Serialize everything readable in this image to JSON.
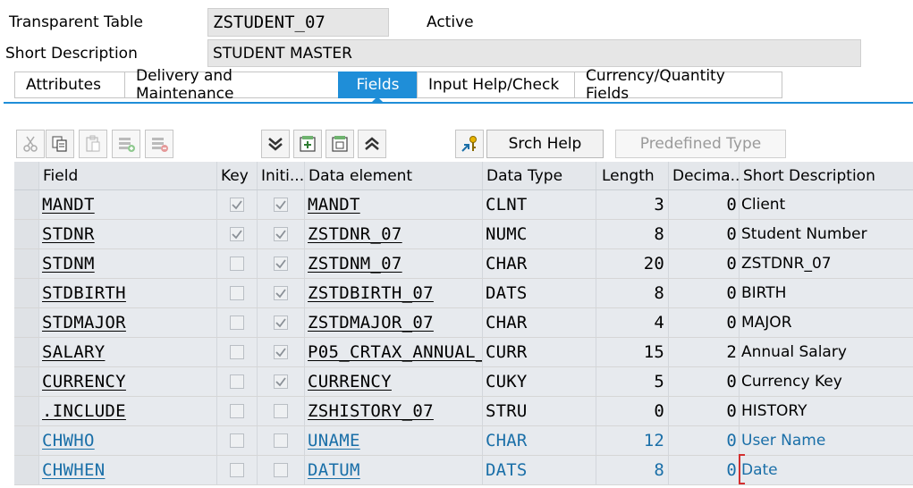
{
  "header": {
    "object_type_label": "Transparent Table",
    "object_name": "ZSTUDENT_07",
    "status": "Active",
    "short_desc_label": "Short Description",
    "short_desc_value": "STUDENT MASTER"
  },
  "tabs": [
    {
      "label": "Attributes",
      "active": false
    },
    {
      "label": "Delivery and Maintenance",
      "active": false
    },
    {
      "label": "Fields",
      "active": true
    },
    {
      "label": "Input Help/Check",
      "active": false
    },
    {
      "label": "Currency/Quantity Fields",
      "active": false
    }
  ],
  "toolbar": {
    "icons": [
      "cut-icon",
      "copy-icon",
      "paste-icon",
      "insert-row-icon",
      "delete-row-icon",
      "collapse-down-icon",
      "add-field-icon",
      "subtract-field-icon",
      "collapse-up-icon",
      "key-search-icon"
    ],
    "srch_help_label": "Srch Help",
    "predefined_type_label": "Predefined Type"
  },
  "table": {
    "columns": [
      "Field",
      "Key",
      "Initi...",
      "Data element",
      "Data Type",
      "Length",
      "Decima...",
      "Short Description"
    ],
    "rows": [
      {
        "field": "MANDT",
        "key": true,
        "init": true,
        "data_element": "MANDT",
        "data_type": "CLNT",
        "length": "3",
        "decimals": "0",
        "desc": "Client",
        "style": "normal"
      },
      {
        "field": "STDNR",
        "key": true,
        "init": true,
        "data_element": "ZSTDNR_07",
        "data_type": "NUMC",
        "length": "8",
        "decimals": "0",
        "desc": "Student Number",
        "style": "normal"
      },
      {
        "field": "STDNM",
        "key": false,
        "init": true,
        "data_element": "ZSTDNM_07",
        "data_type": "CHAR",
        "length": "20",
        "decimals": "0",
        "desc": "ZSTDNR_07",
        "style": "normal"
      },
      {
        "field": "STDBIRTH",
        "key": false,
        "init": true,
        "data_element": "ZSTDBIRTH_07",
        "data_type": "DATS",
        "length": "8",
        "decimals": "0",
        "desc": "BIRTH",
        "style": "normal"
      },
      {
        "field": "STDMAJOR",
        "key": false,
        "init": true,
        "data_element": "ZSTDMAJOR_07",
        "data_type": "CHAR",
        "length": "4",
        "decimals": "0",
        "desc": "MAJOR",
        "style": "normal"
      },
      {
        "field": "SALARY",
        "key": false,
        "init": true,
        "data_element": "P05_CRTAX_ANNUAL_",
        "data_type": "CURR",
        "length": "15",
        "decimals": "2",
        "desc": "Annual Salary",
        "style": "normal"
      },
      {
        "field": "CURRENCY",
        "key": false,
        "init": true,
        "data_element": "CURRENCY",
        "data_type": "CUKY",
        "length": "5",
        "decimals": "0",
        "desc": "Currency Key",
        "style": "normal"
      },
      {
        "field": ".INCLUDE",
        "key": false,
        "init": false,
        "data_element": "ZSHISTORY_07",
        "data_type": "STRU",
        "length": "0",
        "decimals": "0",
        "desc": "HISTORY",
        "style": "normal"
      },
      {
        "field": "CHWHO",
        "key": false,
        "init": false,
        "data_element": "UNAME",
        "data_type": "CHAR",
        "length": "12",
        "decimals": "0",
        "desc": "User Name",
        "style": "blue"
      },
      {
        "field": "CHWHEN",
        "key": false,
        "init": false,
        "data_element": "DATUM",
        "data_type": "DATS",
        "length": "8",
        "decimals": "0",
        "desc": "Date",
        "style": "blue"
      }
    ]
  }
}
